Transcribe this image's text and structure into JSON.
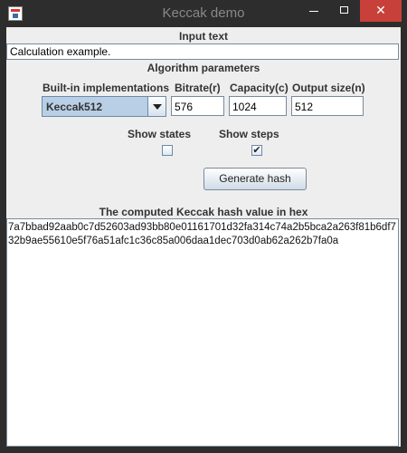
{
  "window": {
    "title": "Keccak demo",
    "close_glyph": "✕"
  },
  "input": {
    "section_title": "Input text",
    "value": "Calculation example."
  },
  "params": {
    "section_title": "Algorithm parameters",
    "builtin_label": "Built-in implementations",
    "builtin_selected": "Keccak512",
    "bitrate_label": "Bitrate(r)",
    "bitrate_value": "576",
    "capacity_label": "Capacity(c)",
    "capacity_value": "1024",
    "output_label": "Output size(n)",
    "output_value": "512",
    "show_states_label": "Show states",
    "show_states_checked": false,
    "show_steps_label": "Show steps",
    "show_steps_checked": true,
    "show_steps_mark": "✔",
    "generate_label": "Generate hash"
  },
  "output": {
    "section_title": "The computed Keccak hash value in hex",
    "hash": "7a7bbad92aab0c7d52603ad93bb80e01161701d32fa314c74a2b5bca2a263f81b6df732b9ae55610e5f76a51afc1c36c85a006daa1dec703d0ab62a262b7fa0a"
  },
  "colors": {
    "titlebar": "#2d2d2d",
    "close_button": "#c7403a",
    "panel": "#eeeeee",
    "combo_selected": "#b8cfe5"
  }
}
